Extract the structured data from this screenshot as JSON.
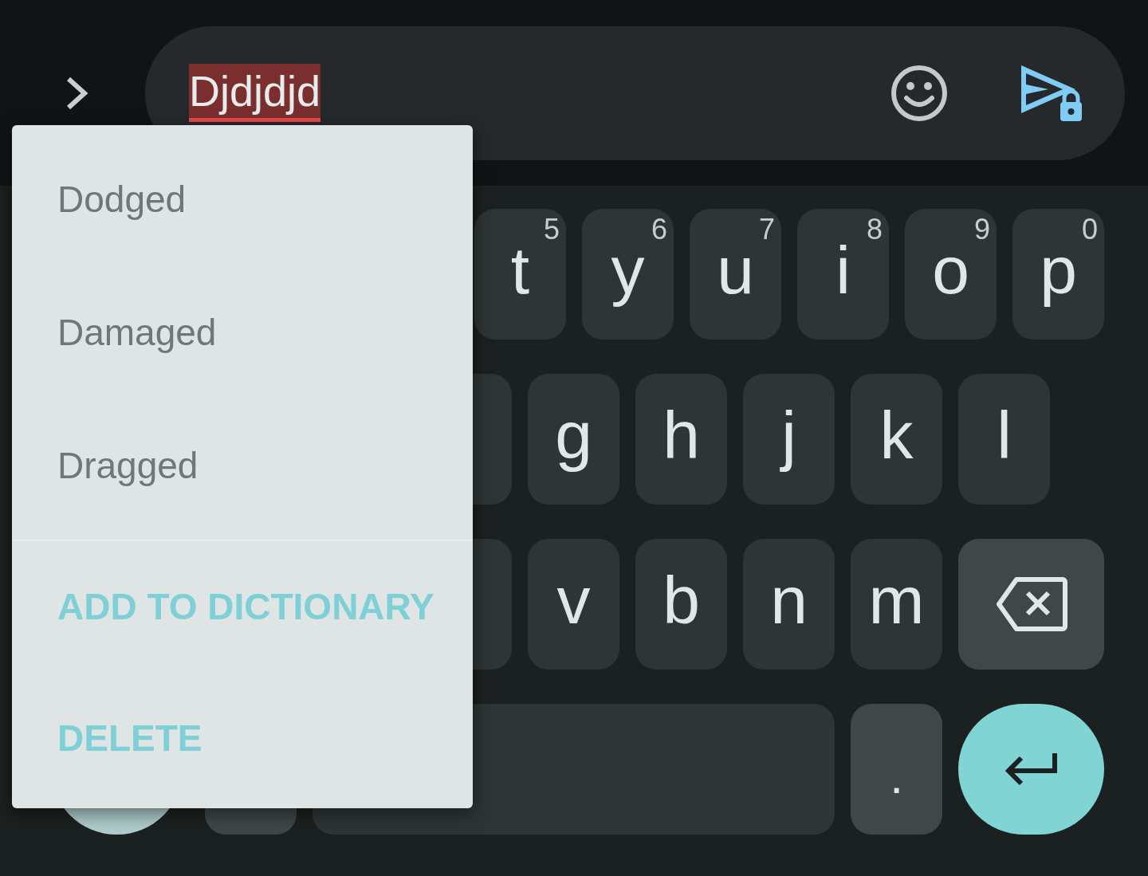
{
  "compose": {
    "value": "Djdjdjd",
    "misspelled": true
  },
  "keyboard": {
    "letter_rows": [
      [
        {
          "kind": "letter",
          "label": "t",
          "hint": "5"
        },
        {
          "kind": "letter",
          "label": "y",
          "hint": "6"
        },
        {
          "kind": "letter",
          "label": "u",
          "hint": "7"
        },
        {
          "kind": "letter",
          "label": "i",
          "hint": "8"
        },
        {
          "kind": "letter",
          "label": "o",
          "hint": "9"
        },
        {
          "kind": "letter",
          "label": "p",
          "hint": "0"
        }
      ],
      [
        {
          "kind": "letter"
        },
        {
          "kind": "letter",
          "label": "g"
        },
        {
          "kind": "letter",
          "label": "h"
        },
        {
          "kind": "letter",
          "label": "j"
        },
        {
          "kind": "letter",
          "label": "k"
        },
        {
          "kind": "letter",
          "label": "l"
        }
      ],
      [
        {
          "kind": "letter"
        },
        {
          "kind": "letter",
          "label": "v"
        },
        {
          "kind": "letter",
          "label": "b"
        },
        {
          "kind": "letter",
          "label": "n"
        },
        {
          "kind": "letter",
          "label": "m"
        },
        {
          "kind": "backspace"
        }
      ]
    ],
    "bottom_row": {
      "left_keys": [
        {
          "kind": "round"
        },
        {
          "kind": "function"
        },
        {
          "kind": "space"
        }
      ],
      "period_key": ".",
      "enter_key": {
        "kind": "enter"
      }
    }
  },
  "spell_menu": {
    "suggestions": [
      "Dodged",
      "Damaged",
      "Dragged"
    ],
    "actions": [
      "ADD TO DICTIONARY",
      "DELETE"
    ]
  }
}
